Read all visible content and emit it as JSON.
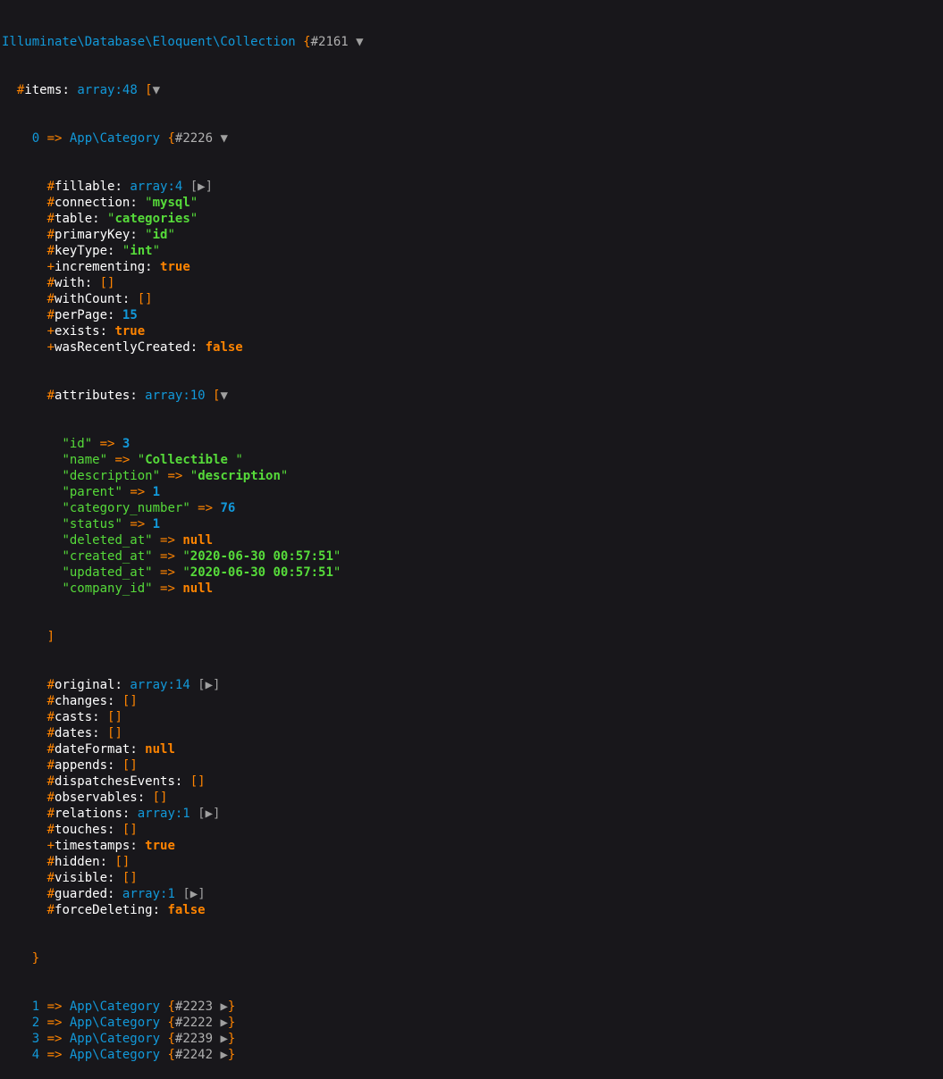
{
  "header": {
    "class_name": "Illuminate\\Database\\Eloquent\\Collection",
    "open": " {",
    "ref": "#2161",
    "toggle": " ▼"
  },
  "items_line": {
    "marker": "#",
    "name": "items",
    "colon": ": ",
    "type": "array:48",
    "open": " [",
    "toggle": "▼"
  },
  "item0": {
    "index": "0",
    "arrow": " => ",
    "class_name": "App\\Category",
    "open": " {",
    "ref": "#2226",
    "toggle": " ▼"
  },
  "props_top": [
    {
      "marker": "#",
      "name": "fillable",
      "kind": "array",
      "value": "array:4",
      "toggle": " [▶]"
    },
    {
      "marker": "#",
      "name": "connection",
      "kind": "string",
      "value": "mysql"
    },
    {
      "marker": "#",
      "name": "table",
      "kind": "string",
      "value": "categories"
    },
    {
      "marker": "#",
      "name": "primaryKey",
      "kind": "string",
      "value": "id"
    },
    {
      "marker": "#",
      "name": "keyType",
      "kind": "string",
      "value": "int"
    },
    {
      "marker": "+",
      "name": "incrementing",
      "kind": "bool",
      "value": "true"
    },
    {
      "marker": "#",
      "name": "with",
      "kind": "empty",
      "value": "[]"
    },
    {
      "marker": "#",
      "name": "withCount",
      "kind": "empty",
      "value": "[]"
    },
    {
      "marker": "#",
      "name": "perPage",
      "kind": "number",
      "value": "15"
    },
    {
      "marker": "+",
      "name": "exists",
      "kind": "bool",
      "value": "true"
    },
    {
      "marker": "+",
      "name": "wasRecentlyCreated",
      "kind": "bool",
      "value": "false"
    }
  ],
  "attributes": {
    "marker": "#",
    "name": "attributes",
    "type": "array:10",
    "open": " [",
    "toggle": "▼",
    "close": "]",
    "entries": [
      {
        "key": "id",
        "kind": "number",
        "value": "3"
      },
      {
        "key": "name",
        "kind": "string",
        "value": "Collectible "
      },
      {
        "key": "description",
        "kind": "string",
        "value": "description"
      },
      {
        "key": "parent",
        "kind": "number",
        "value": "1"
      },
      {
        "key": "category_number",
        "kind": "number",
        "value": "76"
      },
      {
        "key": "status",
        "kind": "number",
        "value": "1"
      },
      {
        "key": "deleted_at",
        "kind": "bool",
        "value": "null"
      },
      {
        "key": "created_at",
        "kind": "string",
        "value": "2020-06-30 00:57:51"
      },
      {
        "key": "updated_at",
        "kind": "string",
        "value": "2020-06-30 00:57:51"
      },
      {
        "key": "company_id",
        "kind": "bool",
        "value": "null"
      }
    ]
  },
  "props_bottom": [
    {
      "marker": "#",
      "name": "original",
      "kind": "array",
      "value": "array:14",
      "toggle": " [▶]"
    },
    {
      "marker": "#",
      "name": "changes",
      "kind": "empty",
      "value": "[]"
    },
    {
      "marker": "#",
      "name": "casts",
      "kind": "empty",
      "value": "[]"
    },
    {
      "marker": "#",
      "name": "dates",
      "kind": "empty",
      "value": "[]"
    },
    {
      "marker": "#",
      "name": "dateFormat",
      "kind": "bool",
      "value": "null"
    },
    {
      "marker": "#",
      "name": "appends",
      "kind": "empty",
      "value": "[]"
    },
    {
      "marker": "#",
      "name": "dispatchesEvents",
      "kind": "empty",
      "value": "[]"
    },
    {
      "marker": "#",
      "name": "observables",
      "kind": "empty",
      "value": "[]"
    },
    {
      "marker": "#",
      "name": "relations",
      "kind": "array",
      "value": "array:1",
      "toggle": " [▶]"
    },
    {
      "marker": "#",
      "name": "touches",
      "kind": "empty",
      "value": "[]"
    },
    {
      "marker": "+",
      "name": "timestamps",
      "kind": "bool",
      "value": "true"
    },
    {
      "marker": "#",
      "name": "hidden",
      "kind": "empty",
      "value": "[]"
    },
    {
      "marker": "#",
      "name": "visible",
      "kind": "empty",
      "value": "[]"
    },
    {
      "marker": "#",
      "name": "guarded",
      "kind": "array",
      "value": "array:1",
      "toggle": " [▶]"
    },
    {
      "marker": "#",
      "name": "forceDeleting",
      "kind": "bool",
      "value": "false"
    }
  ],
  "item0_close": "}",
  "collapsed_items": [
    {
      "index": "1",
      "class_name": "App\\Category",
      "ref": "#2223"
    },
    {
      "index": "2",
      "class_name": "App\\Category",
      "ref": "#2222"
    },
    {
      "index": "3",
      "class_name": "App\\Category",
      "ref": "#2239"
    },
    {
      "index": "4",
      "class_name": "App\\Category",
      "ref": "#2242"
    }
  ],
  "collapsed_suffix": {
    "arrow": " => ",
    "open": " {",
    "toggle": " ▶",
    "close": "}"
  },
  "colors": {
    "background": "#18171b",
    "class": "#1299da",
    "keyword": "#ff8400",
    "string": "#56db3a",
    "text": "#ffffff"
  }
}
